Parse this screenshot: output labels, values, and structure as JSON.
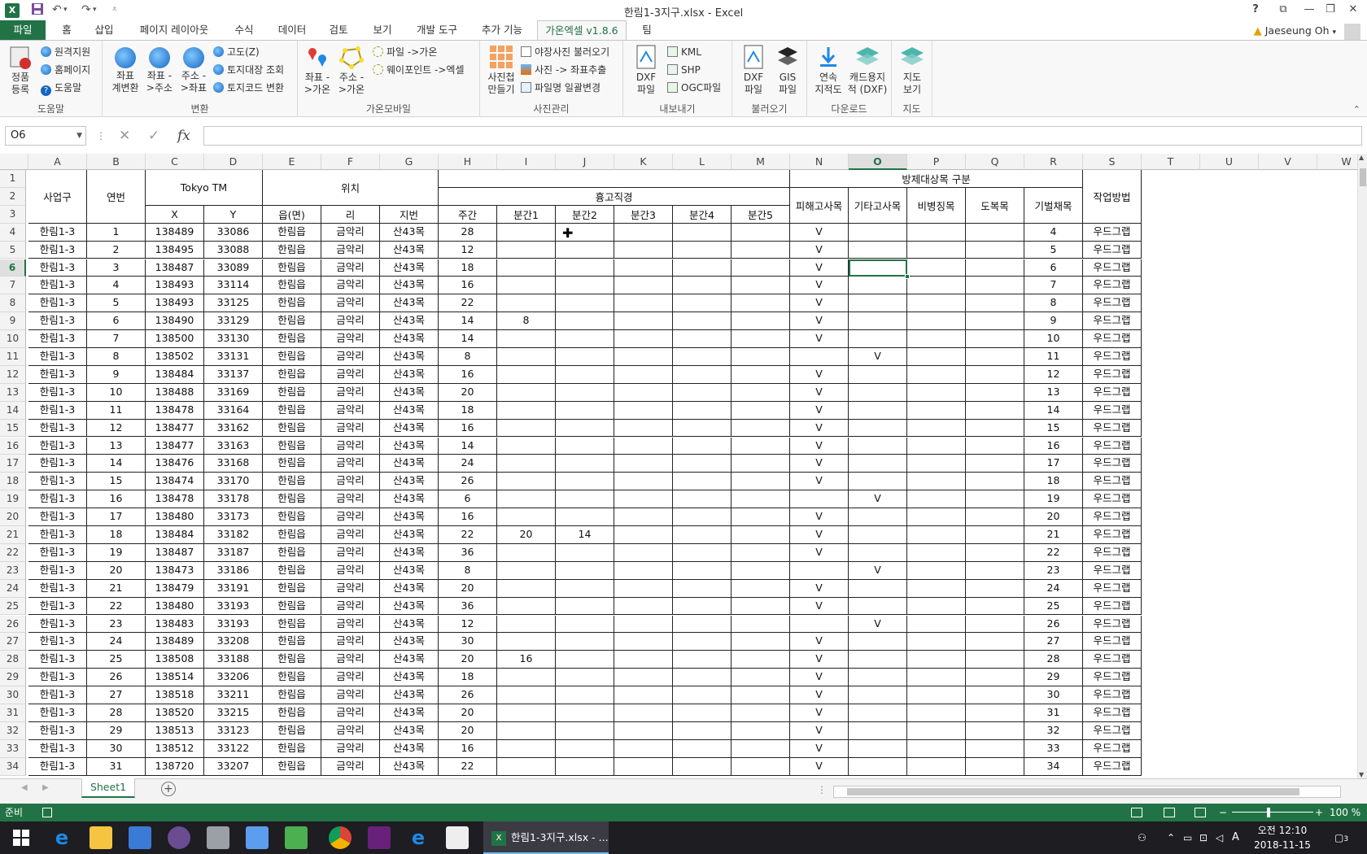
{
  "window": {
    "title": "한림1-3지구.xlsx - Excel"
  },
  "qat": {
    "undo": "↶",
    "redo": "↷"
  },
  "tabs": [
    "파일",
    "홈",
    "삽입",
    "페이지 레이아웃",
    "수식",
    "데이터",
    "검토",
    "보기",
    "개발 도구",
    "추가 기능",
    "가온엑셀 v1.8.6",
    "팀"
  ],
  "user": {
    "name": "Jaeseung Oh"
  },
  "ribbon": {
    "help": {
      "label": "도움말",
      "register1": "정품",
      "register2": "등록",
      "remote": "원격지원",
      "homepage": "홈페이지",
      "helpbtn": "도움말"
    },
    "convert": {
      "label": "변환",
      "b1a": "좌표",
      "b1b": "계변환",
      "b2a": "좌표 -",
      "b2b": ">주소",
      "b3a": "주소 -",
      "b3b": ">좌표",
      "s1": "고도(Z)",
      "s2": "토지대장 조회",
      "s3": "토지코드 변환"
    },
    "mobile": {
      "label": "가온모바일",
      "b1a": "좌표 -",
      "b1b": ">가온",
      "b2a": "주소 -",
      "b2b": ">가온",
      "s1": "파일 ->가온",
      "s2": "웨이포인트 ->엑셀"
    },
    "photo": {
      "label": "사진관리",
      "b1a": "사진첩",
      "b1b": "만들기",
      "s1": "야장사진 불러오기",
      "s2": "사진 -> 좌표추출",
      "s3": "파일명 일괄변경"
    },
    "export": {
      "label": "내보내기",
      "b1a": "DXF",
      "b1b": "파일",
      "s1": "KML",
      "s2": "SHP",
      "s3": "OGC파일"
    },
    "import": {
      "label": "불러오기",
      "b1a": "DXF",
      "b1b": "파일",
      "b2a": "GIS",
      "b2b": "파일"
    },
    "download": {
      "label": "다운로드",
      "b1a": "연속",
      "b1b": "지적도",
      "b2a": "캐드용지",
      "b2b": "적 (DXF)"
    },
    "map": {
      "label": "지도",
      "b1a": "지도",
      "b1b": "보기"
    }
  },
  "formula": {
    "namebox": "O6",
    "fx": "fx",
    "value": ""
  },
  "columns": [
    "A",
    "B",
    "C",
    "D",
    "E",
    "F",
    "G",
    "H",
    "I",
    "J",
    "K",
    "L",
    "M",
    "N",
    "O",
    "P",
    "Q",
    "R",
    "S",
    "T",
    "U",
    "V",
    "W"
  ],
  "selected_column": "O",
  "selected_row": "6",
  "headers": {
    "district": "사업구",
    "num": "연번",
    "tokyo": "Tokyo TM",
    "x": "X",
    "y": "Y",
    "location": "위치",
    "eup": "읍(면)",
    "ri": "리",
    "jibun": "지번",
    "dbh": "흉고직경",
    "trunk": "주간",
    "b1": "분간1",
    "b2": "분간2",
    "b3": "분간3",
    "b4": "분간4",
    "b5": "분간5",
    "category": "방제대상목 구분",
    "damaged": "피해고사목",
    "other": "기타고사목",
    "symptom": "비병징목",
    "fallen": "도복목",
    "individual": "기벌채목",
    "method": "작업방법"
  },
  "rows": [
    {
      "r": "4",
      "a": "한림1-3",
      "b": "1",
      "c": "138489",
      "d": "33086",
      "e": "한림읍",
      "f": "금악리",
      "g": "산43목",
      "h": "28",
      "i": "",
      "j": "",
      "n": "V",
      "o": "",
      "s": "우드그랩"
    },
    {
      "r": "5",
      "a": "한림1-3",
      "b": "2",
      "c": "138495",
      "d": "33088",
      "e": "한림읍",
      "f": "금악리",
      "g": "산43목",
      "h": "12",
      "i": "",
      "j": "",
      "n": "V",
      "o": "",
      "s": "우드그랩"
    },
    {
      "r": "6",
      "a": "한림1-3",
      "b": "3",
      "c": "138487",
      "d": "33089",
      "e": "한림읍",
      "f": "금악리",
      "g": "산43목",
      "h": "18",
      "i": "",
      "j": "",
      "n": "V",
      "o": "",
      "s": "우드그랩"
    },
    {
      "r": "7",
      "a": "한림1-3",
      "b": "4",
      "c": "138493",
      "d": "33114",
      "e": "한림읍",
      "f": "금악리",
      "g": "산43목",
      "h": "16",
      "i": "",
      "j": "",
      "n": "V",
      "o": "",
      "s": "우드그랩"
    },
    {
      "r": "8",
      "a": "한림1-3",
      "b": "5",
      "c": "138493",
      "d": "33125",
      "e": "한림읍",
      "f": "금악리",
      "g": "산43목",
      "h": "22",
      "i": "",
      "j": "",
      "n": "V",
      "o": "",
      "s": "우드그랩"
    },
    {
      "r": "9",
      "a": "한림1-3",
      "b": "6",
      "c": "138490",
      "d": "33129",
      "e": "한림읍",
      "f": "금악리",
      "g": "산43목",
      "h": "14",
      "i": "8",
      "j": "",
      "n": "V",
      "o": "",
      "s": "우드그랩"
    },
    {
      "r": "10",
      "a": "한림1-3",
      "b": "7",
      "c": "138500",
      "d": "33130",
      "e": "한림읍",
      "f": "금악리",
      "g": "산43목",
      "h": "14",
      "i": "",
      "j": "",
      "n": "V",
      "o": "",
      "s": "우드그랩"
    },
    {
      "r": "11",
      "a": "한림1-3",
      "b": "8",
      "c": "138502",
      "d": "33131",
      "e": "한림읍",
      "f": "금악리",
      "g": "산43목",
      "h": "8",
      "i": "",
      "j": "",
      "n": "",
      "o": "V",
      "s": "우드그랩"
    },
    {
      "r": "12",
      "a": "한림1-3",
      "b": "9",
      "c": "138484",
      "d": "33137",
      "e": "한림읍",
      "f": "금악리",
      "g": "산43목",
      "h": "16",
      "i": "",
      "j": "",
      "n": "V",
      "o": "",
      "s": "우드그랩"
    },
    {
      "r": "13",
      "a": "한림1-3",
      "b": "10",
      "c": "138488",
      "d": "33169",
      "e": "한림읍",
      "f": "금악리",
      "g": "산43목",
      "h": "20",
      "i": "",
      "j": "",
      "n": "V",
      "o": "",
      "s": "우드그랩"
    },
    {
      "r": "14",
      "a": "한림1-3",
      "b": "11",
      "c": "138478",
      "d": "33164",
      "e": "한림읍",
      "f": "금악리",
      "g": "산43목",
      "h": "18",
      "i": "",
      "j": "",
      "n": "V",
      "o": "",
      "s": "우드그랩"
    },
    {
      "r": "15",
      "a": "한림1-3",
      "b": "12",
      "c": "138477",
      "d": "33162",
      "e": "한림읍",
      "f": "금악리",
      "g": "산43목",
      "h": "16",
      "i": "",
      "j": "",
      "n": "V",
      "o": "",
      "s": "우드그랩"
    },
    {
      "r": "16",
      "a": "한림1-3",
      "b": "13",
      "c": "138477",
      "d": "33163",
      "e": "한림읍",
      "f": "금악리",
      "g": "산43목",
      "h": "14",
      "i": "",
      "j": "",
      "n": "V",
      "o": "",
      "s": "우드그랩"
    },
    {
      "r": "17",
      "a": "한림1-3",
      "b": "14",
      "c": "138476",
      "d": "33168",
      "e": "한림읍",
      "f": "금악리",
      "g": "산43목",
      "h": "24",
      "i": "",
      "j": "",
      "n": "V",
      "o": "",
      "s": "우드그랩"
    },
    {
      "r": "18",
      "a": "한림1-3",
      "b": "15",
      "c": "138474",
      "d": "33170",
      "e": "한림읍",
      "f": "금악리",
      "g": "산43목",
      "h": "26",
      "i": "",
      "j": "",
      "n": "V",
      "o": "",
      "s": "우드그랩"
    },
    {
      "r": "19",
      "a": "한림1-3",
      "b": "16",
      "c": "138478",
      "d": "33178",
      "e": "한림읍",
      "f": "금악리",
      "g": "산43목",
      "h": "6",
      "i": "",
      "j": "",
      "n": "",
      "o": "V",
      "s": "우드그랩"
    },
    {
      "r": "20",
      "a": "한림1-3",
      "b": "17",
      "c": "138480",
      "d": "33173",
      "e": "한림읍",
      "f": "금악리",
      "g": "산43목",
      "h": "16",
      "i": "",
      "j": "",
      "n": "V",
      "o": "",
      "s": "우드그랩"
    },
    {
      "r": "21",
      "a": "한림1-3",
      "b": "18",
      "c": "138484",
      "d": "33182",
      "e": "한림읍",
      "f": "금악리",
      "g": "산43목",
      "h": "22",
      "i": "20",
      "j": "14",
      "n": "V",
      "o": "",
      "s": "우드그랩"
    },
    {
      "r": "22",
      "a": "한림1-3",
      "b": "19",
      "c": "138487",
      "d": "33187",
      "e": "한림읍",
      "f": "금악리",
      "g": "산43목",
      "h": "36",
      "i": "",
      "j": "",
      "n": "V",
      "o": "",
      "s": "우드그랩"
    },
    {
      "r": "23",
      "a": "한림1-3",
      "b": "20",
      "c": "138473",
      "d": "33186",
      "e": "한림읍",
      "f": "금악리",
      "g": "산43목",
      "h": "8",
      "i": "",
      "j": "",
      "n": "",
      "o": "V",
      "s": "우드그랩"
    },
    {
      "r": "24",
      "a": "한림1-3",
      "b": "21",
      "c": "138479",
      "d": "33191",
      "e": "한림읍",
      "f": "금악리",
      "g": "산43목",
      "h": "20",
      "i": "",
      "j": "",
      "n": "V",
      "o": "",
      "s": "우드그랩"
    },
    {
      "r": "25",
      "a": "한림1-3",
      "b": "22",
      "c": "138480",
      "d": "33193",
      "e": "한림읍",
      "f": "금악리",
      "g": "산43목",
      "h": "36",
      "i": "",
      "j": "",
      "n": "V",
      "o": "",
      "s": "우드그랩"
    },
    {
      "r": "26",
      "a": "한림1-3",
      "b": "23",
      "c": "138483",
      "d": "33193",
      "e": "한림읍",
      "f": "금악리",
      "g": "산43목",
      "h": "12",
      "i": "",
      "j": "",
      "n": "",
      "o": "V",
      "s": "우드그랩"
    },
    {
      "r": "27",
      "a": "한림1-3",
      "b": "24",
      "c": "138489",
      "d": "33208",
      "e": "한림읍",
      "f": "금악리",
      "g": "산43목",
      "h": "30",
      "i": "",
      "j": "",
      "n": "V",
      "o": "",
      "s": "우드그랩"
    },
    {
      "r": "28",
      "a": "한림1-3",
      "b": "25",
      "c": "138508",
      "d": "33188",
      "e": "한림읍",
      "f": "금악리",
      "g": "산43목",
      "h": "20",
      "i": "16",
      "j": "",
      "n": "V",
      "o": "",
      "s": "우드그랩"
    },
    {
      "r": "29",
      "a": "한림1-3",
      "b": "26",
      "c": "138514",
      "d": "33206",
      "e": "한림읍",
      "f": "금악리",
      "g": "산43목",
      "h": "18",
      "i": "",
      "j": "",
      "n": "V",
      "o": "",
      "s": "우드그랩"
    },
    {
      "r": "30",
      "a": "한림1-3",
      "b": "27",
      "c": "138518",
      "d": "33211",
      "e": "한림읍",
      "f": "금악리",
      "g": "산43목",
      "h": "26",
      "i": "",
      "j": "",
      "n": "V",
      "o": "",
      "s": "우드그랩"
    },
    {
      "r": "31",
      "a": "한림1-3",
      "b": "28",
      "c": "138520",
      "d": "33215",
      "e": "한림읍",
      "f": "금악리",
      "g": "산43목",
      "h": "20",
      "i": "",
      "j": "",
      "n": "V",
      "o": "",
      "s": "우드그랩"
    },
    {
      "r": "32",
      "a": "한림1-3",
      "b": "29",
      "c": "138513",
      "d": "33123",
      "e": "한림읍",
      "f": "금악리",
      "g": "산43목",
      "h": "20",
      "i": "",
      "j": "",
      "n": "V",
      "o": "",
      "s": "우드그랩"
    },
    {
      "r": "33",
      "a": "한림1-3",
      "b": "30",
      "c": "138512",
      "d": "33122",
      "e": "한림읍",
      "f": "금악리",
      "g": "산43목",
      "h": "16",
      "i": "",
      "j": "",
      "n": "V",
      "o": "",
      "s": "우드그랩"
    },
    {
      "r": "34",
      "a": "한림1-3",
      "b": "31",
      "c": "138720",
      "d": "33207",
      "e": "한림읍",
      "f": "금악리",
      "g": "산43목",
      "h": "22",
      "i": "",
      "j": "",
      "n": "V",
      "o": "",
      "s": "우드그랩"
    }
  ],
  "sheet": {
    "tab": "Sheet1"
  },
  "status": {
    "ready": "준비",
    "zoom": "100 %"
  },
  "taskbar": {
    "app": "한림1-3지구.xlsx - ...",
    "time": "오전 12:10",
    "date": "2018-11-15",
    "ime": "A",
    "notif": "3"
  },
  "colors": {
    "accent": "#217346",
    "taskbar": "#1d1d22"
  }
}
